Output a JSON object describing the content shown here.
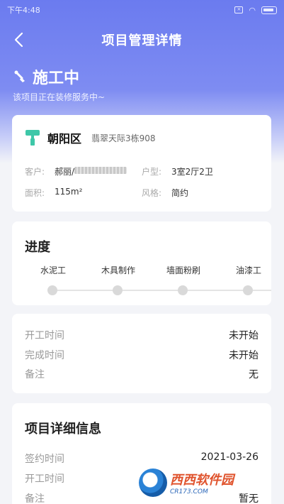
{
  "statusbar": {
    "time": "下午4:48"
  },
  "header": {
    "title": "项目管理详情"
  },
  "status": {
    "title": "施工中",
    "subtitle": "该项目正在装修服务中~"
  },
  "project": {
    "district": "朝阳区",
    "community": "翡翠天际3栋908",
    "customer_label": "客户:",
    "customer_value": "郝丽/",
    "layout_label": "户型:",
    "layout_value": "3室2厅2卫",
    "area_label": "面积:",
    "area_value": "115m²",
    "style_label": "风格:",
    "style_value": "简约"
  },
  "progress": {
    "title": "进度",
    "steps": [
      "水泥工",
      "木具制作",
      "墙面粉刷",
      "油漆工"
    ]
  },
  "times": {
    "start_label": "开工时间",
    "start_value": "未开始",
    "finish_label": "完成时间",
    "finish_value": "未开始",
    "note_label": "备注",
    "note_value": "无"
  },
  "detail": {
    "title": "项目详细信息",
    "sign_label": "签约时间",
    "sign_value": "2021-03-26",
    "start_label": "开工时间",
    "start_value": "",
    "note_label": "备注",
    "note_value": "暂无"
  },
  "watermark": {
    "main": "西西软件园",
    "sub": "CR173.COM"
  }
}
